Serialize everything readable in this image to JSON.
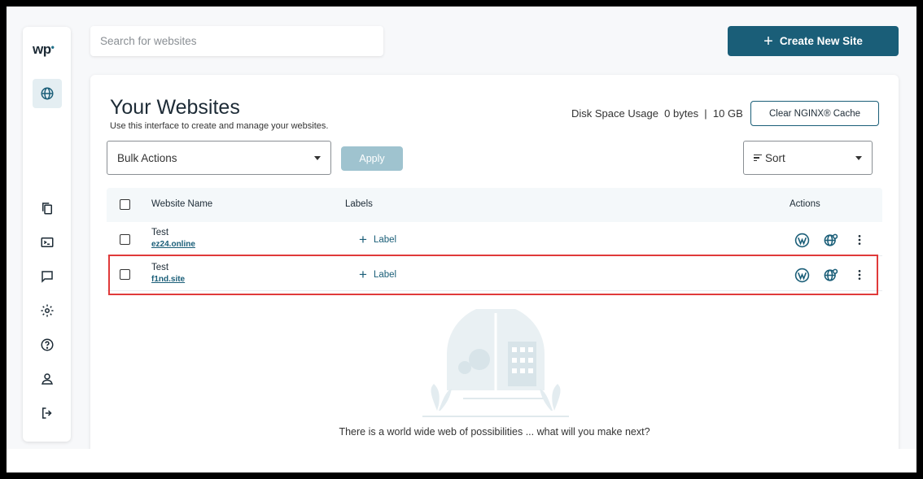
{
  "sidebar": {
    "logo": "wp",
    "items": [
      {
        "name": "globe-icon",
        "active": true
      },
      {
        "name": "copy-icon"
      },
      {
        "name": "terminal-icon"
      },
      {
        "name": "chat-icon"
      },
      {
        "name": "gear-icon"
      },
      {
        "name": "help-icon"
      },
      {
        "name": "user-icon"
      },
      {
        "name": "logout-icon"
      }
    ]
  },
  "search": {
    "placeholder": "Search for websites"
  },
  "create_button": {
    "label": "Create New Site",
    "color": "#1a5e78"
  },
  "main": {
    "title": "Your Websites",
    "subtitle": "Use this interface to create and manage your websites.",
    "disk_usage": "Disk Space Usage  0 bytes  |  10 GB",
    "clear_cache_label": "Clear NGINX® Cache",
    "bulk_actions_label": "Bulk Actions",
    "apply_label": "Apply",
    "sort_label": "Sort"
  },
  "table": {
    "headers": {
      "name": "Website Name",
      "labels": "Labels",
      "actions": "Actions"
    },
    "rows": [
      {
        "name": "Test",
        "url": "ez24.online",
        "label_action": "Label"
      },
      {
        "name": "Test",
        "url": "f1nd.site",
        "label_action": "Label"
      }
    ]
  },
  "empty_state": {
    "text": "There is a world wide web of possibilities ... what will you make next?"
  },
  "colors": {
    "accent": "#1a5e78",
    "highlight": "#e03a3a"
  }
}
